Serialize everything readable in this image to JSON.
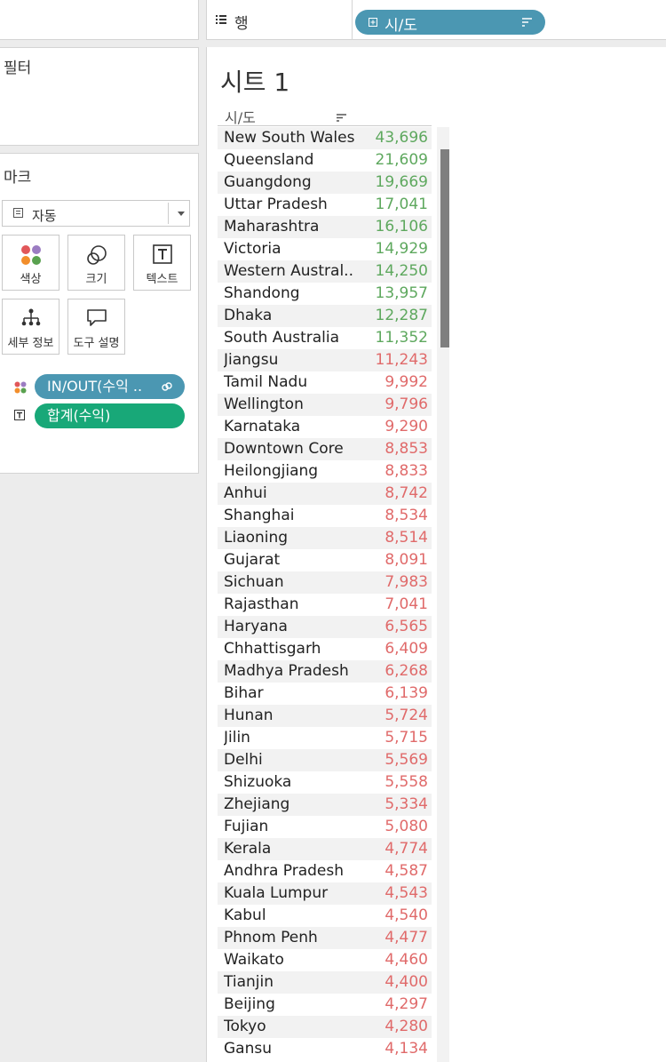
{
  "filters": {
    "title": "필터"
  },
  "marks": {
    "title": "마크",
    "mark_type": "자동",
    "buttons": [
      {
        "label": "색상",
        "icon": "color-icon"
      },
      {
        "label": "크기",
        "icon": "size-icon"
      },
      {
        "label": "텍스트",
        "icon": "text-icon"
      },
      {
        "label": "세부 정보",
        "icon": "detail-icon"
      },
      {
        "label": "도구 설명",
        "icon": "tooltip-icon"
      }
    ],
    "fields": [
      {
        "label": "IN/OUT(수익 ..",
        "color": "#4b97b2",
        "icon": "color-icon"
      },
      {
        "label": "합계(수익)",
        "color": "#18a878",
        "icon": "text-icon"
      }
    ]
  },
  "shelf": {
    "rows_label": "행",
    "rows_pill": "시/도"
  },
  "sheet": {
    "title": "시트 1",
    "column_header": "시/도",
    "in_color": "#5ea85e",
    "out_color": "#e06a6a",
    "rows": [
      {
        "name": "New South Wales",
        "value": "43,696",
        "in": true
      },
      {
        "name": "Queensland",
        "value": "21,609",
        "in": true
      },
      {
        "name": "Guangdong",
        "value": "19,669",
        "in": true
      },
      {
        "name": "Uttar Pradesh",
        "value": "17,041",
        "in": true
      },
      {
        "name": "Maharashtra",
        "value": "16,106",
        "in": true
      },
      {
        "name": "Victoria",
        "value": "14,929",
        "in": true
      },
      {
        "name": "Western Austral..",
        "value": "14,250",
        "in": true
      },
      {
        "name": "Shandong",
        "value": "13,957",
        "in": true
      },
      {
        "name": "Dhaka",
        "value": "12,287",
        "in": true
      },
      {
        "name": "South Australia",
        "value": "11,352",
        "in": true
      },
      {
        "name": "Jiangsu",
        "value": "11,243",
        "in": false
      },
      {
        "name": "Tamil Nadu",
        "value": "9,992",
        "in": false
      },
      {
        "name": "Wellington",
        "value": "9,796",
        "in": false
      },
      {
        "name": "Karnataka",
        "value": "9,290",
        "in": false
      },
      {
        "name": "Downtown Core",
        "value": "8,853",
        "in": false
      },
      {
        "name": "Heilongjiang",
        "value": "8,833",
        "in": false
      },
      {
        "name": "Anhui",
        "value": "8,742",
        "in": false
      },
      {
        "name": "Shanghai",
        "value": "8,534",
        "in": false
      },
      {
        "name": "Liaoning",
        "value": "8,514",
        "in": false
      },
      {
        "name": "Gujarat",
        "value": "8,091",
        "in": false
      },
      {
        "name": "Sichuan",
        "value": "7,983",
        "in": false
      },
      {
        "name": "Rajasthan",
        "value": "7,041",
        "in": false
      },
      {
        "name": "Haryana",
        "value": "6,565",
        "in": false
      },
      {
        "name": "Chhattisgarh",
        "value": "6,409",
        "in": false
      },
      {
        "name": "Madhya Pradesh",
        "value": "6,268",
        "in": false
      },
      {
        "name": "Bihar",
        "value": "6,139",
        "in": false
      },
      {
        "name": "Hunan",
        "value": "5,724",
        "in": false
      },
      {
        "name": "Jilin",
        "value": "5,715",
        "in": false
      },
      {
        "name": "Delhi",
        "value": "5,569",
        "in": false
      },
      {
        "name": "Shizuoka",
        "value": "5,558",
        "in": false
      },
      {
        "name": "Zhejiang",
        "value": "5,334",
        "in": false
      },
      {
        "name": "Fujian",
        "value": "5,080",
        "in": false
      },
      {
        "name": "Kerala",
        "value": "4,774",
        "in": false
      },
      {
        "name": "Andhra Pradesh",
        "value": "4,587",
        "in": false
      },
      {
        "name": "Kuala Lumpur",
        "value": "4,543",
        "in": false
      },
      {
        "name": "Kabul",
        "value": "4,540",
        "in": false
      },
      {
        "name": "Phnom Penh",
        "value": "4,477",
        "in": false
      },
      {
        "name": "Waikato",
        "value": "4,460",
        "in": false
      },
      {
        "name": "Tianjin",
        "value": "4,400",
        "in": false
      },
      {
        "name": "Beijing",
        "value": "4,297",
        "in": false
      },
      {
        "name": "Tokyo",
        "value": "4,280",
        "in": false
      },
      {
        "name": "Gansu",
        "value": "4,134",
        "in": false
      }
    ]
  }
}
